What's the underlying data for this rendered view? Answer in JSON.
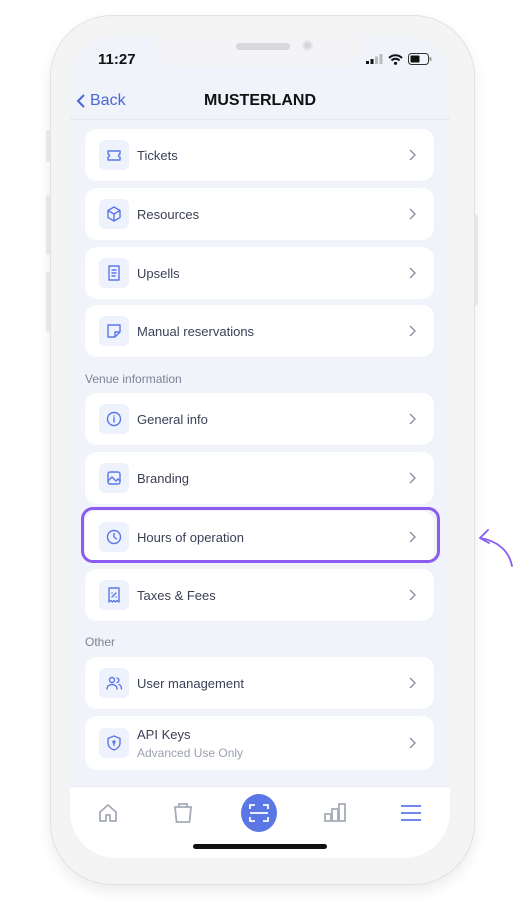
{
  "status_bar": {
    "time": "11:27"
  },
  "header": {
    "back_label": "Back",
    "title": "MUSTERLAND"
  },
  "groups": [
    {
      "items": [
        {
          "label": "Tickets",
          "icon": "ticket-icon"
        },
        {
          "label": "Resources",
          "icon": "cube-icon"
        },
        {
          "label": "Upsells",
          "icon": "receipt-icon"
        },
        {
          "label": "Manual reservations",
          "icon": "note-icon"
        }
      ]
    },
    {
      "title": "Venue information",
      "items": [
        {
          "label": "General info",
          "icon": "info-icon"
        },
        {
          "label": "Branding",
          "icon": "image-icon"
        },
        {
          "label": "Hours of operation",
          "icon": "clock-icon",
          "highlighted": true
        },
        {
          "label": "Taxes & Fees",
          "icon": "tax-receipt-icon"
        }
      ]
    },
    {
      "title": "Other",
      "items": [
        {
          "label": "User management",
          "icon": "users-icon"
        },
        {
          "label": "API Keys",
          "sublabel": "Advanced Use Only",
          "icon": "shield-icon"
        }
      ]
    }
  ],
  "tab_bar": {
    "tabs": [
      "home-icon",
      "shopping-bag-icon",
      "scan-icon",
      "chart-icon",
      "menu-icon"
    ],
    "active": "menu-icon"
  },
  "colors": {
    "accent": "#5b77e6",
    "highlight": "#8a5cf0",
    "background": "#f0f3f9"
  }
}
